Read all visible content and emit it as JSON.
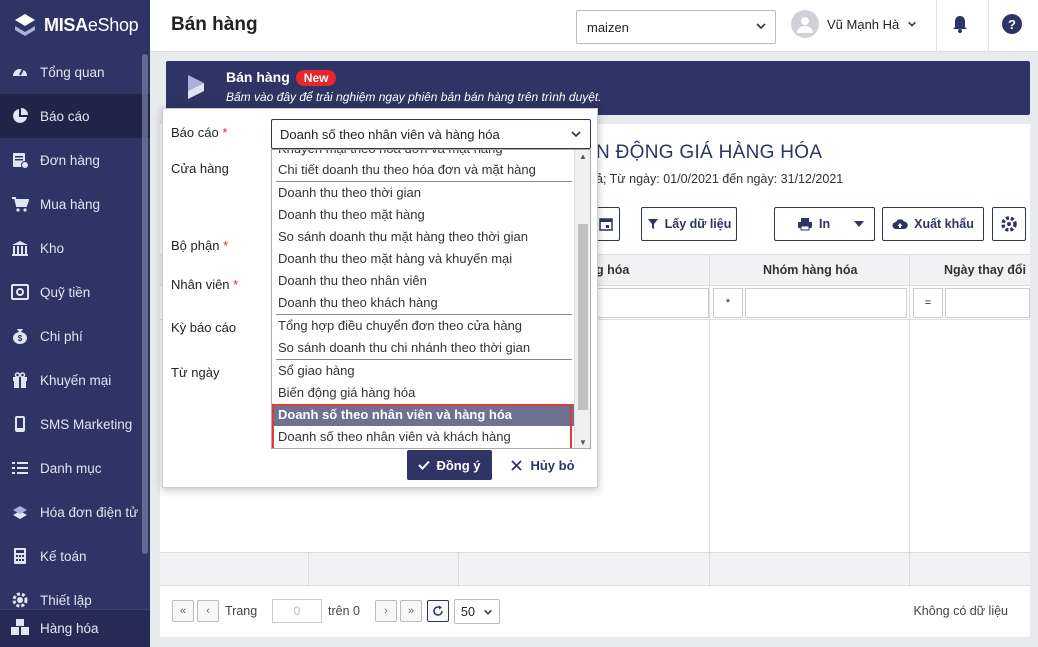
{
  "app": {
    "brand_bold": "MISA",
    "brand_rest": "eShop"
  },
  "sidebar": {
    "items": [
      {
        "label": "Tổng quan",
        "icon": "gauge-icon",
        "active": false
      },
      {
        "label": "Báo cáo",
        "icon": "pie-chart-icon",
        "active": true
      },
      {
        "label": "Đơn hàng",
        "icon": "order-icon",
        "active": false
      },
      {
        "label": "Mua hàng",
        "icon": "cart-icon",
        "active": false
      },
      {
        "label": "Kho",
        "icon": "warehouse-icon",
        "active": false
      },
      {
        "label": "Quỹ tiền",
        "icon": "safe-icon",
        "active": false
      },
      {
        "label": "Chi phí",
        "icon": "money-bag-icon",
        "active": false
      },
      {
        "label": "Khuyến mại",
        "icon": "gift-icon",
        "active": false
      },
      {
        "label": "SMS Marketing",
        "icon": "phone-icon",
        "active": false
      },
      {
        "label": "Danh mục",
        "icon": "list-icon",
        "active": false
      },
      {
        "label": "Hóa đơn điện tử",
        "icon": "invoice-icon",
        "active": false
      },
      {
        "label": "Kế toán",
        "icon": "calculator-icon",
        "active": false
      },
      {
        "label": "Thiết lập",
        "icon": "gear-icon",
        "active": false
      }
    ],
    "bottom_label": "Hàng hóa"
  },
  "header": {
    "title": "Bán hàng",
    "store": "maizen",
    "user_name": "Vũ Mạnh Hà"
  },
  "banner": {
    "title": "Bán hàng",
    "badge": "New",
    "subtitle": "Bấm vào đây để trải nghiệm ngay phiên bản bán hàng trên trình duyệt."
  },
  "report": {
    "title": "N ĐỘNG GIÁ HÀNG HÓA",
    "subtitle": "ả; Từ ngày: 01/0/2021 đến ngày: 31/12/2021",
    "get_data_label": "Lấy dữ liệu",
    "print_label": "In",
    "export_label": "Xuất khẩu",
    "columns": [
      "g hóa",
      "Nhóm hàng hóa",
      "Ngày thay đổi"
    ],
    "filter_ops": [
      "*",
      "="
    ],
    "pager": {
      "page_label": "Trang",
      "page_value": "0",
      "of_label": "trên 0",
      "page_size": "50",
      "empty": "Không có dữ liệu"
    }
  },
  "dialog": {
    "labels": {
      "report": "Báo cáo",
      "store": "Cửa hàng",
      "dept": "Bộ phận",
      "staff": "Nhân viên",
      "period": "Kỳ báo cáo",
      "from": "Từ ngày"
    },
    "required_mark": "*",
    "selected_report": "Doanh số theo nhân viên và hàng hóa",
    "options": [
      "Khuyến mại theo hóa đơn và mặt hàng",
      "Chi tiết doanh thu theo hóa đơn và mặt hàng",
      "Doanh thu theo thời gian",
      "Doanh thu theo mặt hàng",
      "So sánh doanh thu mặt hàng theo thời gian",
      "Doanh thu theo mặt hàng và khuyến mại",
      "Doanh thu theo nhân viên",
      "Doanh thu theo khách hàng",
      "Tổng hợp điều chuyển đơn theo cửa hàng",
      "So sánh doanh thu chi nhánh theo thời gian",
      "Sổ giao hàng",
      "Biến động giá hàng hóa",
      "Doanh số theo nhân viên và hàng hóa",
      "Doanh số theo nhân viên và khách hàng"
    ],
    "ok_label": "Đồng ý",
    "cancel_label": "Hủy bỏ"
  },
  "colors": {
    "sidebar": "#2e3463",
    "accent": "#2e3463",
    "required": "#e8262b",
    "selected_row": "#6f7192",
    "highlight": "#e03a3a"
  }
}
